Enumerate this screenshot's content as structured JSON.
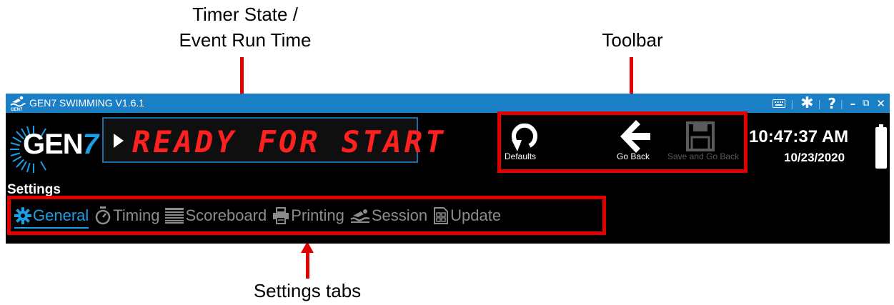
{
  "annotations": {
    "timer_line1": "Timer State /",
    "timer_line2": "Event Run Time",
    "toolbar": "Toolbar",
    "tabs": "Settings tabs"
  },
  "titlebar": {
    "title": "GEN7 SWIMMING V1.6.1",
    "icons": [
      "keyboard-icon",
      "asterisk-icon",
      "help-icon",
      "minimize-icon",
      "restore-icon",
      "close-icon"
    ]
  },
  "logo": {
    "text": "GEN",
    "suffix": "7"
  },
  "timer": {
    "state": "READY FOR START",
    "state_color": "#ff2020"
  },
  "toolbar": {
    "defaults_label": "Defaults",
    "go_back_label": "Go Back",
    "save_label": "Save and Go Back",
    "save_enabled": false
  },
  "clock": {
    "time": "10:47:37 AM",
    "date": "10/23/2020"
  },
  "settings": {
    "title": "Settings",
    "tabs": [
      {
        "label": "General",
        "icon": "gear-icon",
        "active": true
      },
      {
        "label": "Timing",
        "icon": "stopwatch-icon",
        "active": false
      },
      {
        "label": "Scoreboard",
        "icon": "scoreboard-icon",
        "active": false
      },
      {
        "label": "Printing",
        "icon": "printer-icon",
        "active": false
      },
      {
        "label": "Session",
        "icon": "swimmer-icon",
        "active": false
      },
      {
        "label": "Update",
        "icon": "update-icon",
        "active": false
      }
    ]
  },
  "colors": {
    "accent": "#1a9ee6",
    "titlebar": "#1a7fc4",
    "annotation": "#e00000",
    "inactive_tab": "#8c8c8c"
  }
}
